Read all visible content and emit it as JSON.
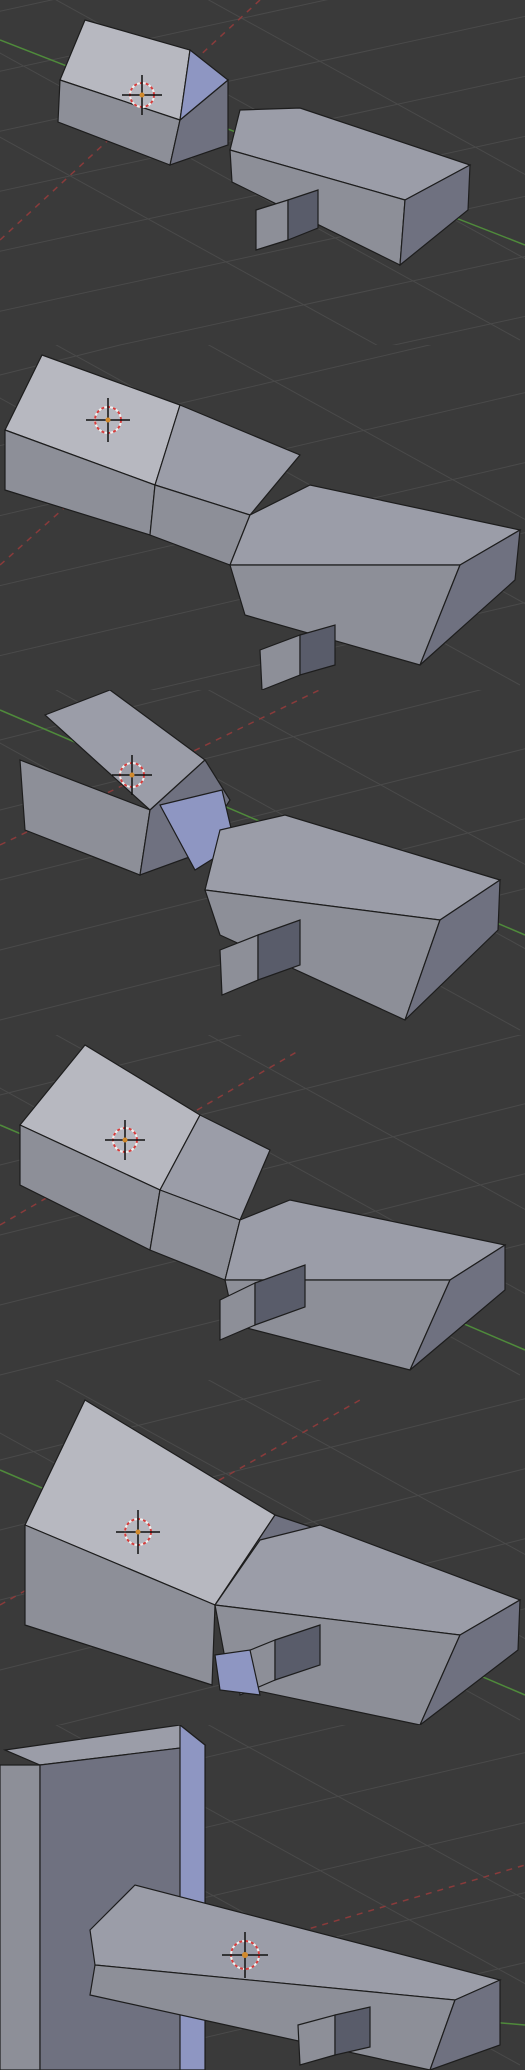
{
  "app": {
    "name": "",
    "view_count": 6
  },
  "viewports": [
    {
      "id": "view-1",
      "label": "",
      "background_color": "#3a3a3a",
      "grid_color": "#4a4a4a",
      "axis_x_color": "#8a3b3b",
      "axis_y_color": "#4f8a3b"
    },
    {
      "id": "view-2",
      "label": "",
      "background_color": "#3a3a3a",
      "grid_color": "#4a4a4a",
      "axis_x_color": "#8a3b3b",
      "axis_y_color": "#4f8a3b"
    },
    {
      "id": "view-3",
      "label": "",
      "background_color": "#3a3a3a",
      "grid_color": "#4a4a4a",
      "axis_x_color": "#8a3b3b",
      "axis_y_color": "#4f8a3b"
    },
    {
      "id": "view-4",
      "label": "",
      "background_color": "#3a3a3a",
      "grid_color": "#4a4a4a",
      "axis_x_color": "#8a3b3b",
      "axis_y_color": "#4f8a3b"
    },
    {
      "id": "view-5",
      "label": "",
      "background_color": "#3a3a3a",
      "grid_color": "#4a4a4a",
      "axis_x_color": "#8a3b3b",
      "axis_y_color": "#4f8a3b"
    },
    {
      "id": "view-6",
      "label": "",
      "background_color": "#3a3a3a",
      "grid_color": "#4a4a4a",
      "axis_x_color": "#8a3b3b",
      "axis_y_color": "#4f8a3b"
    }
  ],
  "icons": {
    "cursor": "3d-cursor-icon"
  }
}
